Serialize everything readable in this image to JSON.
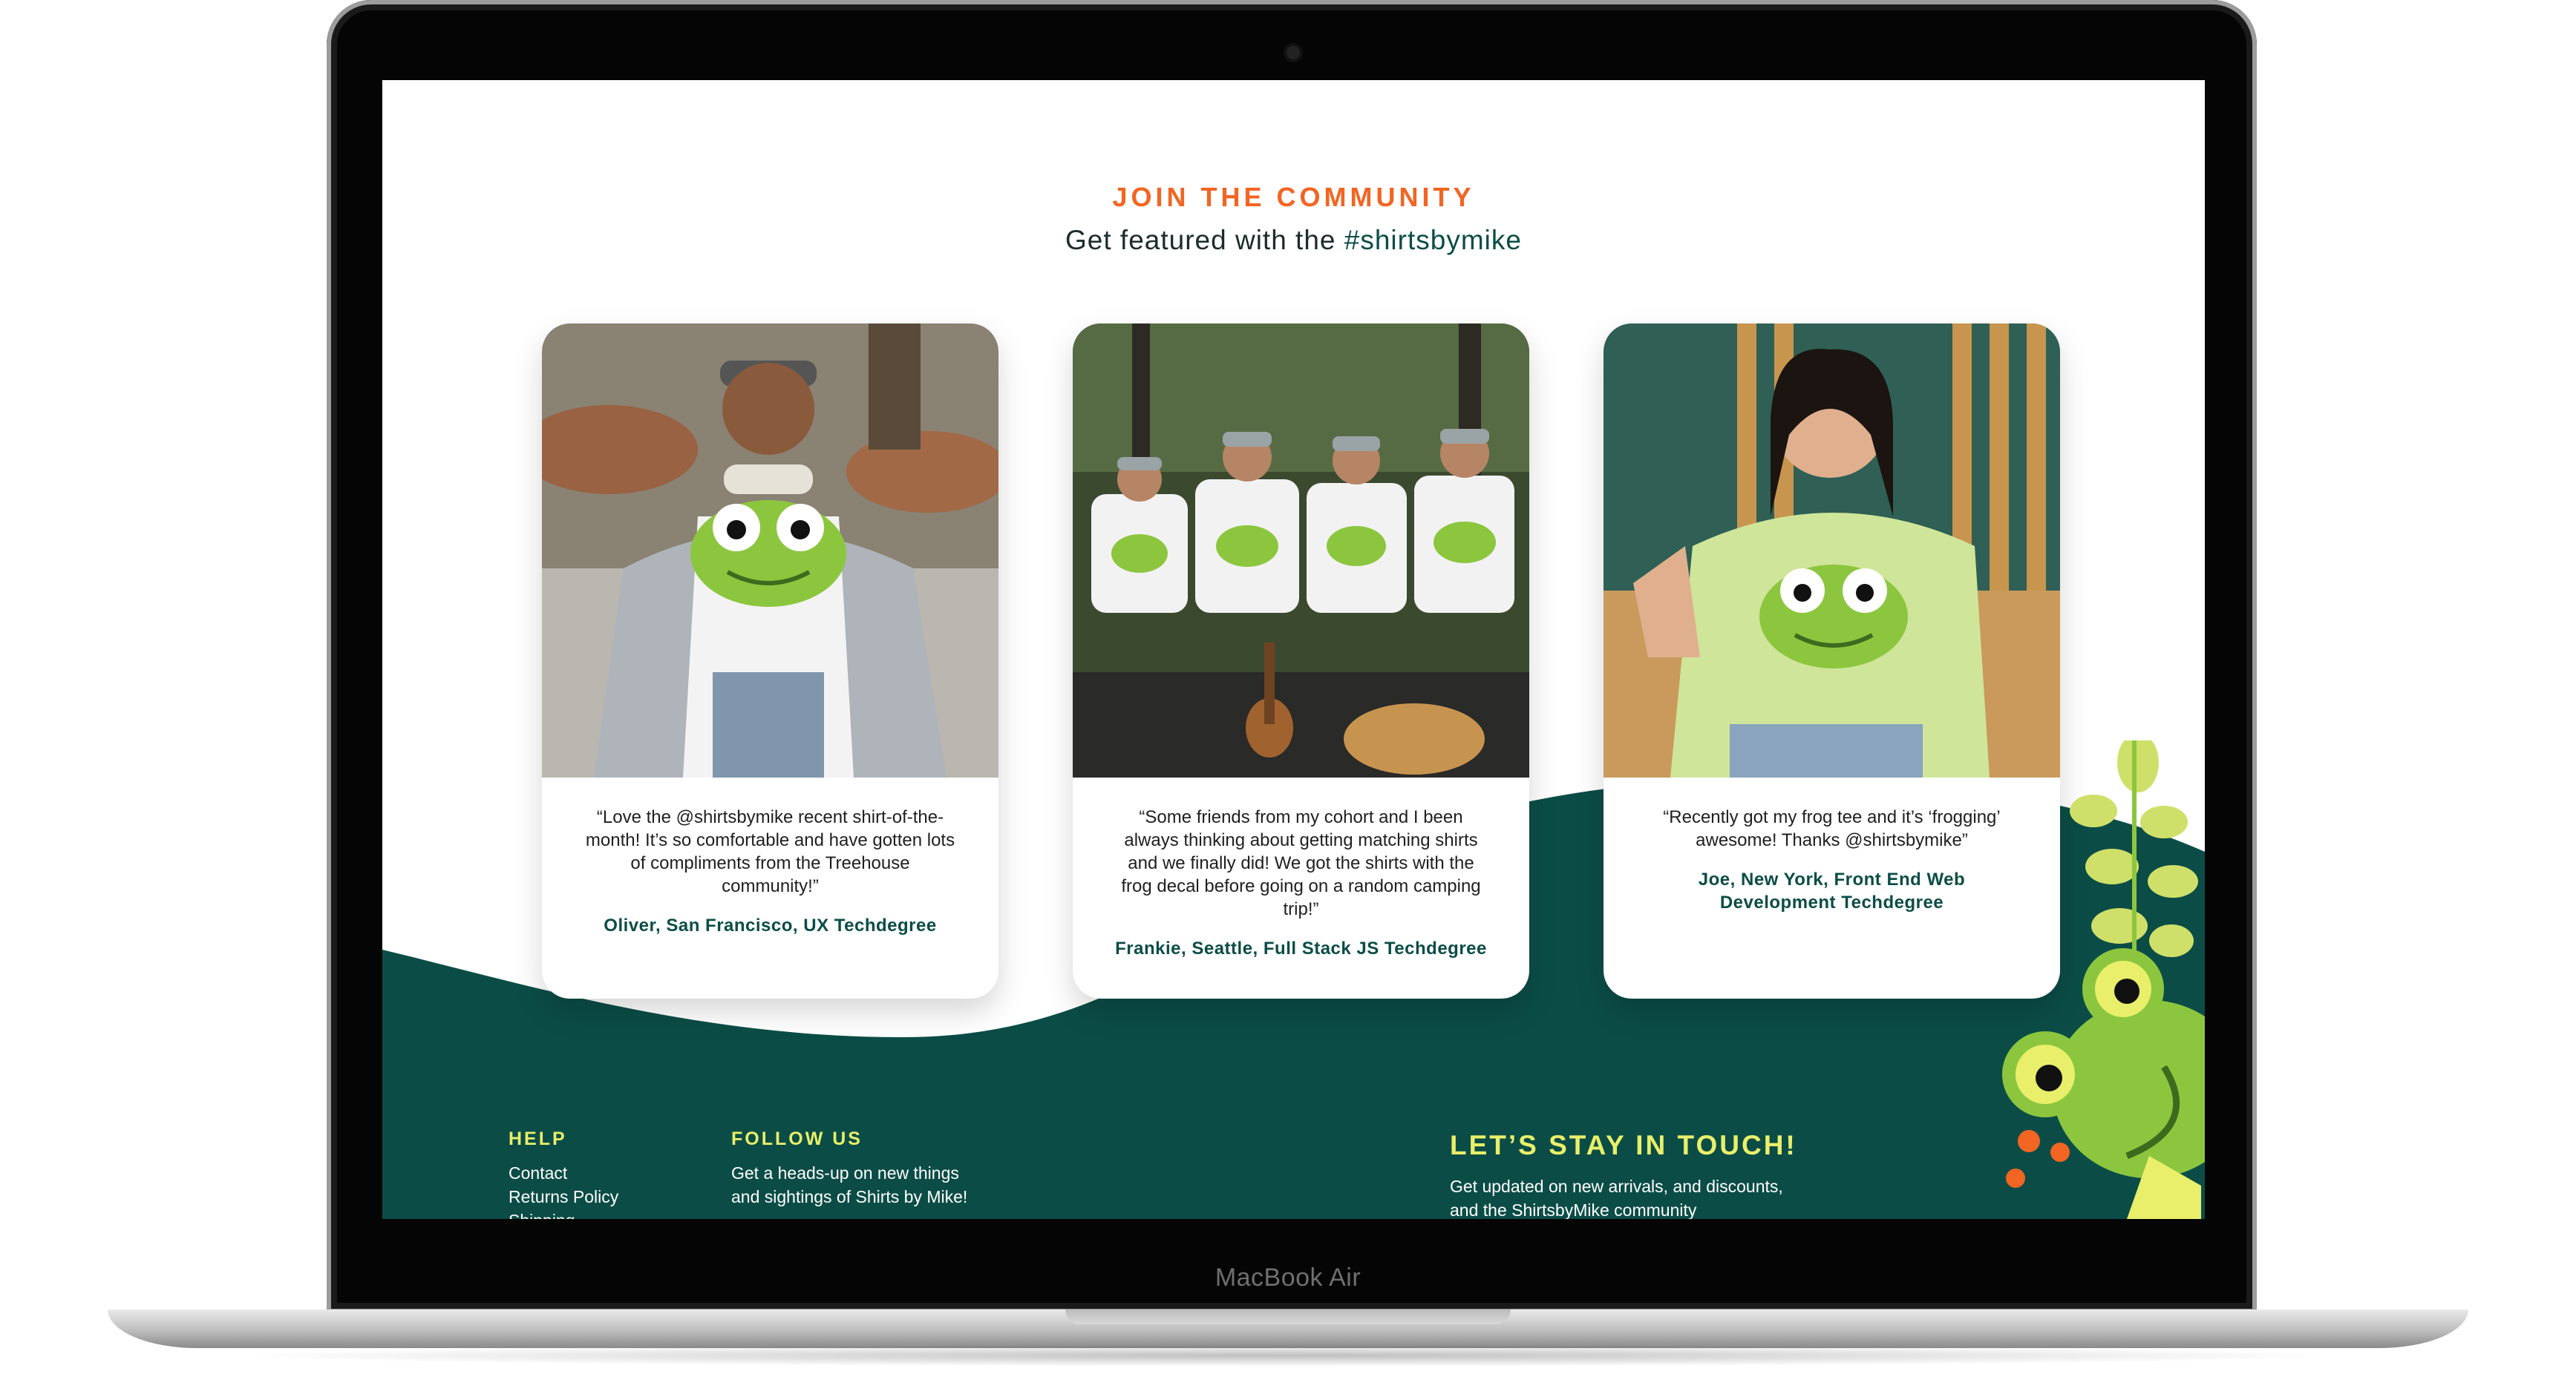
{
  "device": {
    "label": "MacBook Air"
  },
  "community": {
    "eyebrow": "JOIN THE COMMUNITY",
    "title_prefix": "Get featured with the ",
    "hashtag": "#shirtsbymike"
  },
  "testimonials": [
    {
      "quote": "“Love the @shirtsbymike recent shirt-of-the-month! It’s so comfortable and have gotten lots of compliments from the Treehouse community!”",
      "author": "Oliver, San Francisco, UX Techdegree"
    },
    {
      "quote": "“Some friends from my cohort and I been always thinking about getting matching shirts and we finally did! We got the shirts with the frog decal before going on a random camping trip!”",
      "author": "Frankie, Seattle, Full Stack JS Techdegree"
    },
    {
      "quote": "“Recently got my frog tee and it’s ‘frogging’ awesome! Thanks @shirtsbymike”",
      "author": "Joe, New York, Front End Web Development Techdegree"
    }
  ],
  "footer": {
    "help": {
      "heading": "HELP",
      "links": [
        "Contact",
        "Returns Policy",
        "Shipping"
      ]
    },
    "follow": {
      "heading": "FOLLOW US",
      "text_line1": "Get a heads-up on new things",
      "text_line2": "and sightings of Shirts by Mike!"
    },
    "touch": {
      "heading": "LET’S STAY IN TOUCH!",
      "text_line1": "Get updated on new arrivals, and discounts,",
      "text_line2": "and the ShirtsbyMike community"
    }
  },
  "colors": {
    "accent_orange": "#f26522",
    "brand_green": "#0b4d46",
    "footer_heading": "#e9ef6a",
    "frog_green": "#8cc63f"
  }
}
